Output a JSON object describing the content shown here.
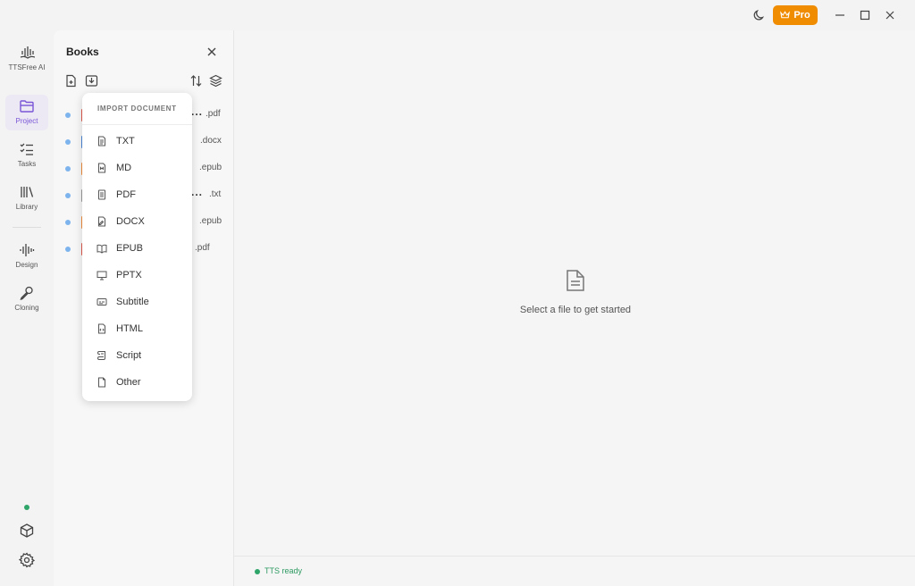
{
  "titlebar": {
    "pro_label": "Pro",
    "icons": [
      "moon-icon",
      "crown-icon",
      "minimize-icon",
      "maximize-icon",
      "close-icon"
    ]
  },
  "rail": {
    "logo_label": "TTSFree AI",
    "items": [
      {
        "label": "Project",
        "icon": "folder-icon",
        "active": true
      },
      {
        "label": "Tasks",
        "icon": "checklist-icon",
        "active": false
      },
      {
        "label": "Library",
        "icon": "library-icon",
        "active": false
      },
      {
        "label": "Design",
        "icon": "waveform-icon",
        "active": false
      },
      {
        "label": "Cloning",
        "icon": "pen-icon",
        "active": false
      }
    ],
    "accent_color": "#7a55d6"
  },
  "books": {
    "title": "Books",
    "items": [
      {
        "ext": ".pdf",
        "truncated": true,
        "marker_color": "#e05a4e"
      },
      {
        "ext": ".docx",
        "truncated": false,
        "marker_color": "#4a86d8"
      },
      {
        "ext": ".epub",
        "truncated": false,
        "marker_color": "#f08c3c"
      },
      {
        "ext": ".txt",
        "truncated": true,
        "marker_color": "#999999"
      },
      {
        "ext": ".epub",
        "truncated": false,
        "marker_color": "#f08c3c"
      },
      {
        "ext": ".pdf",
        "truncated": false,
        "marker_color": "#e05a4e"
      }
    ],
    "ellipsis": "..."
  },
  "import_menu": {
    "header": "IMPORT DOCUMENT",
    "items": [
      {
        "label": "TXT",
        "icon": "text-file-icon"
      },
      {
        "label": "MD",
        "icon": "markdown-file-icon"
      },
      {
        "label": "PDF",
        "icon": "pdf-file-icon"
      },
      {
        "label": "DOCX",
        "icon": "docx-file-icon"
      },
      {
        "label": "EPUB",
        "icon": "book-open-icon"
      },
      {
        "label": "PPTX",
        "icon": "presentation-icon"
      },
      {
        "label": "Subtitle",
        "icon": "subtitle-icon"
      },
      {
        "label": "HTML",
        "icon": "html-file-icon"
      },
      {
        "label": "Script",
        "icon": "script-icon"
      },
      {
        "label": "Other",
        "icon": "file-icon"
      }
    ]
  },
  "main": {
    "empty_text": "Select a file to get started"
  },
  "statusbar": {
    "text": "TTS ready",
    "color": "#2e9a62"
  },
  "colors": {
    "pro_button": "#f08c00",
    "status_green": "#2fa56a",
    "book_dot": "#7db4ee"
  }
}
